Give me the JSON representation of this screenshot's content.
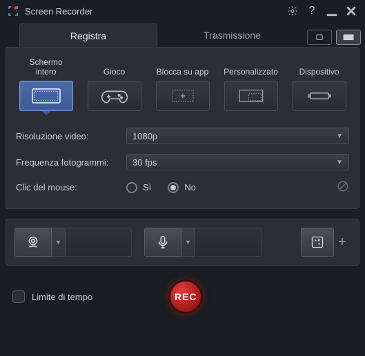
{
  "app": {
    "title": "Screen Recorder"
  },
  "tabs": {
    "record": "Registra",
    "stream": "Trasmissione"
  },
  "modes": {
    "fullscreen": "Schermo\nintero",
    "game": "Gioco",
    "lockapp": "Blocca su app",
    "custom": "Personalizzato",
    "device": "Dispositivo"
  },
  "settings": {
    "resolution_label": "Risoluzione video:",
    "resolution_value": "1080p",
    "framerate_label": "Frequenza fotogrammi:",
    "framerate_value": "30 fps",
    "mouseclick_label": "Clic del mouse:",
    "yes": "Sì",
    "no": "No"
  },
  "footer": {
    "timelimit": "Limite di tempo",
    "rec": "REC"
  }
}
